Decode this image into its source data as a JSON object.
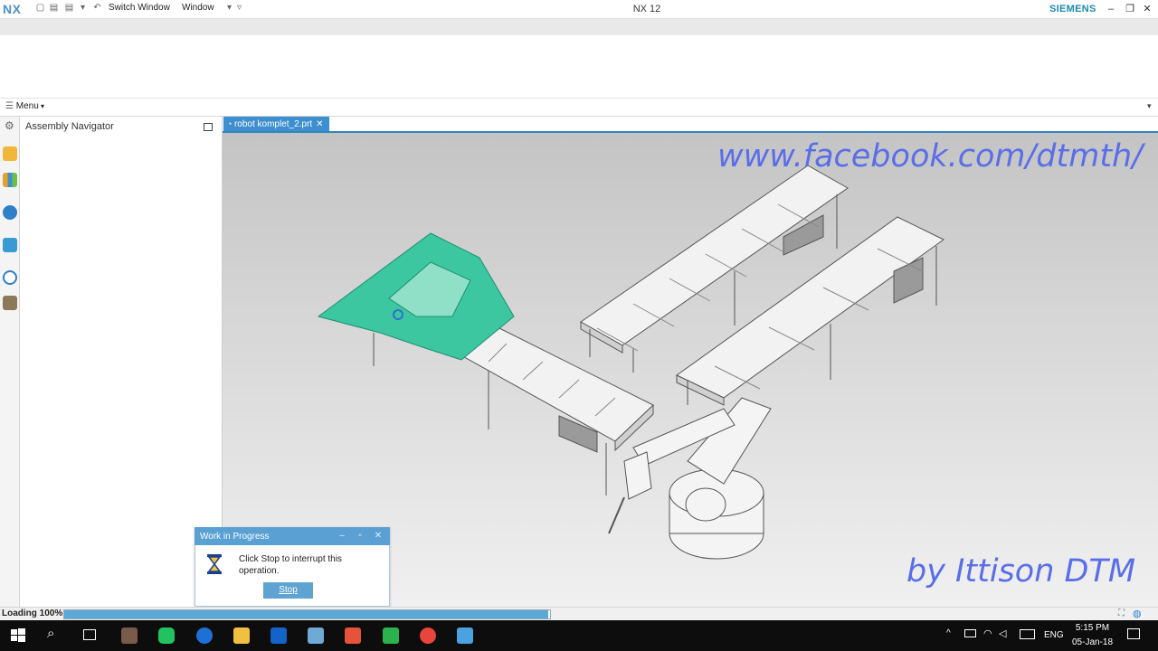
{
  "titlebar": {
    "logo": "NX",
    "switch_window_label": "Switch Window",
    "window_menu_label": "Window",
    "app_title": "NX 12",
    "brand": "SIEMENS"
  },
  "menubar": {
    "menu_label": "Menu"
  },
  "navigator": {
    "title": "Assembly Navigator"
  },
  "graphics": {
    "tab_label": "robot komplet_2.prt",
    "watermark_top": "www.facebook.com/dtmth/",
    "watermark_bottom": "by Ittison DTM"
  },
  "dialog": {
    "title": "Work in Progress",
    "message": "Click Stop to interrupt this operation.",
    "stop_label": "Stop"
  },
  "statusbar": {
    "text": "Loading 100%",
    "progress": 1.0
  },
  "taskbar": {
    "time": "5:15 PM",
    "date": "05-Jan-18",
    "language": "ENG"
  },
  "colors": {
    "accent_blue": "#3d8fd0",
    "part_highlight": "#3cc7a0",
    "watermark": "#5a6ee8"
  }
}
